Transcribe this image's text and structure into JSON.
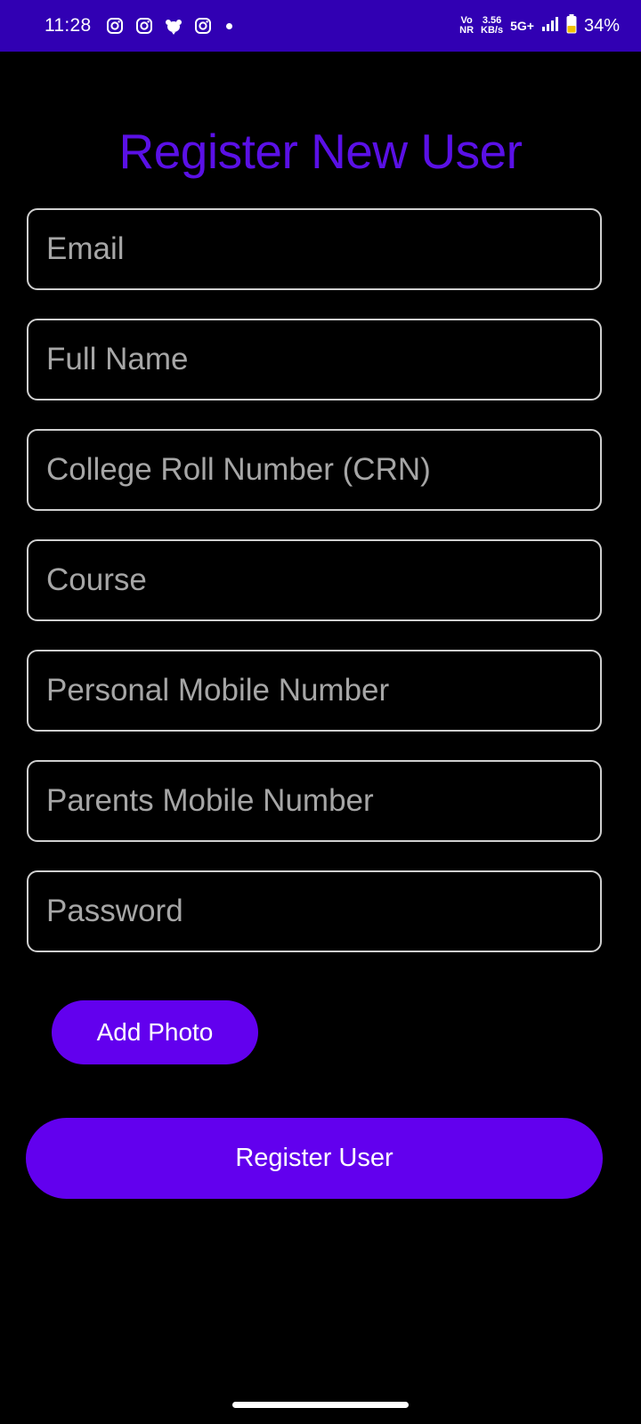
{
  "status_bar": {
    "time": "11:28",
    "volte_top": "Vo",
    "volte_bottom": "NR",
    "speed_value": "3.56",
    "speed_unit": "KB/s",
    "network": "5G+",
    "battery": "34%",
    "bg_color": "#3100b3"
  },
  "title": "Register New User",
  "form": {
    "email": {
      "placeholder": "Email",
      "value": ""
    },
    "full_name": {
      "placeholder": "Full Name",
      "value": ""
    },
    "crn": {
      "placeholder": "College Roll Number (CRN)",
      "value": ""
    },
    "course": {
      "placeholder": "Course",
      "value": ""
    },
    "personal_mobile": {
      "placeholder": "Personal Mobile Number",
      "value": ""
    },
    "parents_mobile": {
      "placeholder": "Parents Mobile Number",
      "value": ""
    },
    "password": {
      "placeholder": "Password",
      "value": ""
    }
  },
  "buttons": {
    "add_photo": "Add Photo",
    "register": "Register User"
  },
  "colors": {
    "accent": "#6200ee",
    "title": "#5a10e6",
    "background": "#000000",
    "field_border": "#cfcfcf",
    "placeholder": "#a6a6a6"
  },
  "icons": {
    "notifications": [
      "instagram-icon",
      "instagram-icon",
      "notification-app-icon",
      "instagram-icon"
    ],
    "status": [
      "signal-icon",
      "battery-icon"
    ]
  }
}
